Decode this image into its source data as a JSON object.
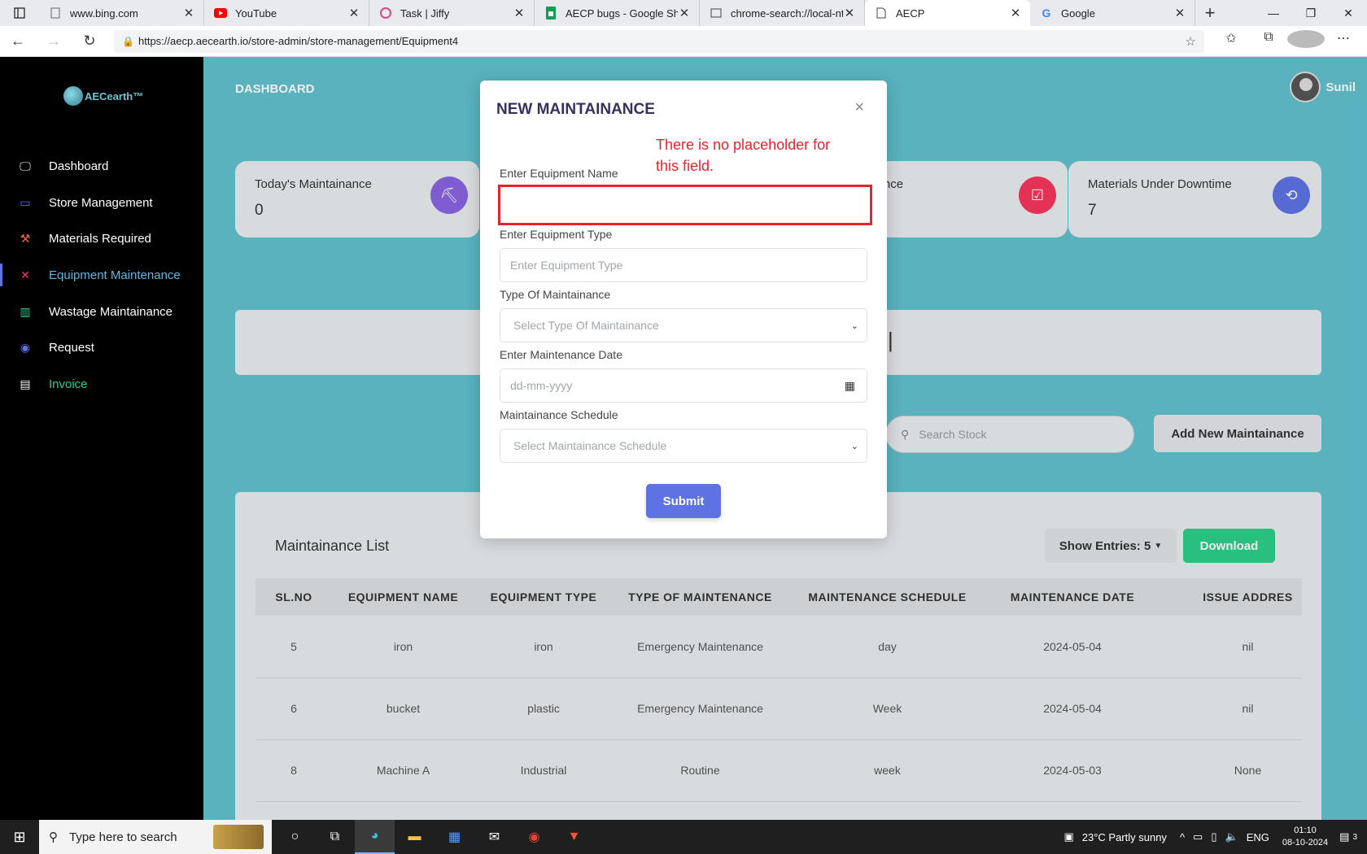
{
  "browser": {
    "tabs": [
      {
        "label": "www.bing.com",
        "icon": "bing-icon"
      },
      {
        "label": "YouTube",
        "icon": "youtube-icon"
      },
      {
        "label": "Task | Jiffy",
        "icon": "jiffy-icon"
      },
      {
        "label": "AECP bugs - Google Shee",
        "icon": "sheets-icon"
      },
      {
        "label": "chrome-search://local-ntp",
        "icon": "page-icon"
      },
      {
        "label": "AECP",
        "icon": "page-icon"
      },
      {
        "label": "Google",
        "icon": "google-icon"
      }
    ],
    "active_tab": 5,
    "url": "https://aecp.aecearth.io/store-admin/store-management/Equipment4"
  },
  "sidebar": {
    "logo": "AECearth™",
    "items": [
      {
        "label": "Dashboard",
        "icon": "monitor-icon"
      },
      {
        "label": "Store Management",
        "icon": "store-icon"
      },
      {
        "label": "Materials Required",
        "icon": "hammer-icon"
      },
      {
        "label": "Equipment Maintenance",
        "icon": "tools-icon"
      },
      {
        "label": "Wastage Maintainance",
        "icon": "trash-icon"
      },
      {
        "label": "Request",
        "icon": "request-icon"
      },
      {
        "label": "Invoice",
        "icon": "invoice-icon"
      }
    ],
    "active": "Equipment Maintenance"
  },
  "header": {
    "title": "DASHBOARD",
    "user": "Sunil"
  },
  "cards": [
    {
      "title": "Today's Maintainance",
      "value": "0"
    },
    {
      "title": "laintainance",
      "value": ""
    },
    {
      "title": "Materials Under Downtime",
      "value": "7"
    }
  ],
  "controls": {
    "search_placeholder": "Search Stock",
    "add_button": "Add New Maintainance"
  },
  "list": {
    "title": "Maintainance List",
    "show_entries": "Show Entries: 5",
    "download": "Download",
    "columns": [
      "SL.NO",
      "EQUIPMENT NAME",
      "EQUIPMENT TYPE",
      "TYPE OF MAINTENANCE",
      "MAINTENANCE SCHEDULE",
      "MAINTENANCE DATE",
      "ISSUE ADDRES"
    ],
    "rows": [
      [
        "5",
        "iron",
        "iron",
        "Emergency Maintenance",
        "day",
        "2024-05-04",
        "nil"
      ],
      [
        "6",
        "bucket",
        "plastic",
        "Emergency Maintenance",
        "Week",
        "2024-05-04",
        "nil"
      ],
      [
        "8",
        "Machine A",
        "Industrial",
        "Routine",
        "week",
        "2024-05-03",
        "None"
      ]
    ]
  },
  "modal": {
    "title": "NEW MAINTAINANCE",
    "close": "×",
    "annotation": "There is no placeholder for this field.",
    "fields": {
      "equipment_name_label": "Enter Equipment Name",
      "equipment_name_value": "",
      "equipment_type_label": "Enter Equipment Type",
      "equipment_type_placeholder": "Enter Equipment Type",
      "maintenance_type_label": "Type Of Maintainance",
      "maintenance_type_value": "Select Type Of Maintainance",
      "date_label": "Enter Maintenance Date",
      "date_placeholder": "dd-mm-yyyy",
      "schedule_label": "Maintainance Schedule",
      "schedule_value": "Select Maintainance Schedule"
    },
    "submit": "Submit"
  },
  "taskbar": {
    "search": "Type here to search",
    "weather": "23°C  Partly sunny",
    "lang": "ENG",
    "time": "01:10",
    "date": "08-10-2024",
    "notifications": "3"
  },
  "colors": {
    "primary": "#5e72e4",
    "success": "#2dce89",
    "main_bg": "#60c0cd",
    "annotation": "#e8232b"
  }
}
